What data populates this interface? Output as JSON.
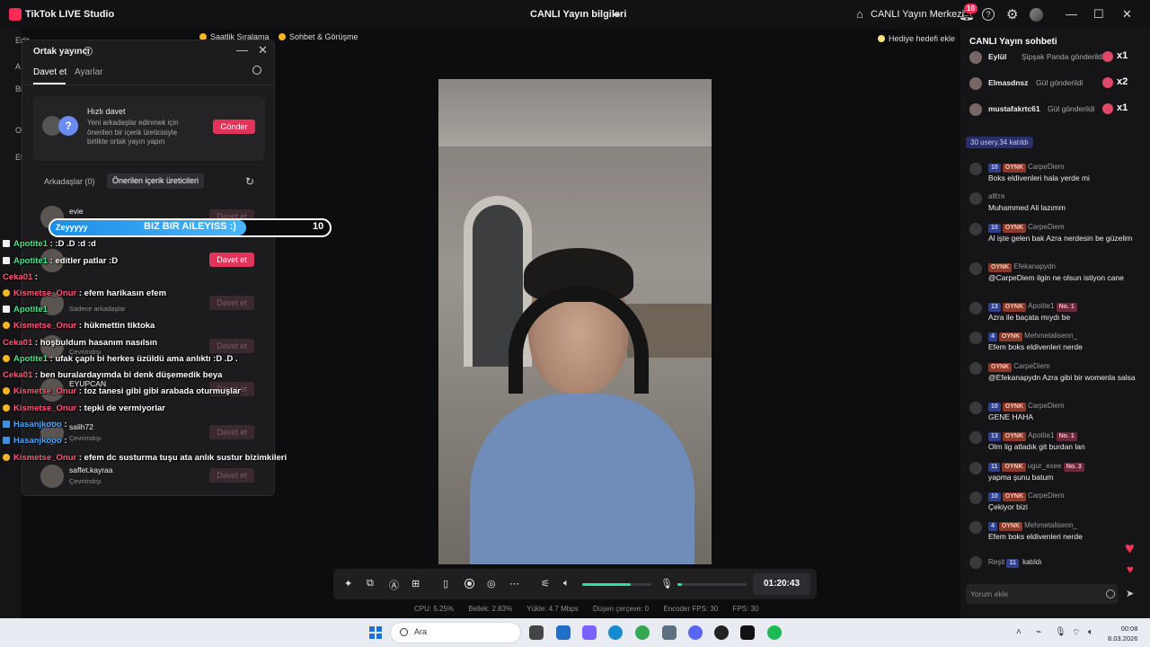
{
  "titlebar": {
    "app_name": "TikTok LIVE Studio",
    "center_title": "CANLI Yayın bilgileri",
    "live_center": "CANLI Yayın Merkezi",
    "notification_count": "10"
  },
  "top_pills": {
    "ranking": "Saatlik Sıralama",
    "chat": "Sohbet & Görüşme",
    "gift_goal": "Hediye hedefi ekle"
  },
  "left_edge": [
    "Edit",
    "A",
    "Bi",
    "O",
    "Et"
  ],
  "cohost_panel": {
    "title": "Ortak yayıncı",
    "tabs": [
      "Davet et",
      "Ayarlar"
    ],
    "quick_invite": {
      "title": "Hızlı davet",
      "description": "Yeni arkadaşlar edinmek için önerilen bir içerik üreticisiyle birlikte ortak yayın yapın",
      "button": "Gönder"
    },
    "list_tabs": [
      "Arkadaşlar (0)",
      "Önerilen içerik üreticileri"
    ],
    "people": [
      {
        "name": "evie",
        "sub": "",
        "button": "Davet et"
      },
      {
        "name": "",
        "sub": "",
        "button": "Davet et"
      },
      {
        "name": "",
        "sub": "Sadece arkadaşlar",
        "button": "Davet et"
      },
      {
        "name": "",
        "sub": "Çevrimdışı",
        "button": "Davet et"
      },
      {
        "name": "EYUPCAN",
        "sub": "",
        "button": "Davet et"
      },
      {
        "name": "salih72",
        "sub": "Çevrimdışı",
        "button": "Davet et"
      },
      {
        "name": "saffet.kayraa",
        "sub": "Çevrimdışı",
        "button": "Davet et"
      }
    ]
  },
  "overlay_goal": {
    "name": "Zeyyyyy",
    "text": "BIZ BIR AILEYISS :)",
    "count": "10",
    "progress": 0.7
  },
  "overlay_chat": [
    {
      "user": "Apotite1",
      "text": ": :D .D :d :d"
    },
    {
      "user": "Apotite1",
      "text": ": editler patlar :D"
    },
    {
      "user": "Ceka01",
      "text": ":"
    },
    {
      "user": "Kismetse_Onur",
      "text": ": efem harikasın efem"
    },
    {
      "user": "Apotite1",
      "text": ""
    },
    {
      "user": "Kismetse_Onur",
      "text": ": hükmettin tiktoka"
    },
    {
      "user": "Ceka01",
      "text": ": hoşbuldum hasanım nasılsın"
    },
    {
      "user": "Apotite1",
      "text": ": ufak çaplı bi herkes üzüldü ama anlıktı :D .D ."
    },
    {
      "user": "Ceka01",
      "text": ": ben buralardayımda bi denk düşemedik beya"
    },
    {
      "user": "Kismetse_Onur",
      "text": ": toz tanesi gibi gibi arabada oturmuşlar"
    },
    {
      "user": "Kismetse_Onur",
      "text": ": tepki de vermiyorlar"
    },
    {
      "user": "Hasanjkooo",
      "text": ":"
    },
    {
      "user": "Hasanjkooo",
      "text": ":"
    },
    {
      "user": "Kismetse_Onur",
      "text": ": efem dc susturma tuşu ata anlık sustur bizimkileri"
    }
  ],
  "right_chat": {
    "title": "CANLI Yayın sohbeti",
    "gifts": [
      {
        "user": "Eylül",
        "action": "Şipşak Panda gönderildi",
        "count": "x1"
      },
      {
        "user": "Elmasdnsz",
        "action": "Gül gönderildi",
        "count": "x2"
      },
      {
        "user": "mustafakrtc61",
        "action": "Gül gönderildi",
        "count": "x1"
      }
    ],
    "joined": {
      "level": "30",
      "text": "usery.34 katıldı"
    },
    "messages": [
      {
        "level": "10",
        "tag": "OYNK",
        "user": "CarpeDiem",
        "no": "",
        "text": "Boks eldivenleri hala yerde mi"
      },
      {
        "level": "",
        "tag": "",
        "user": "alltтя",
        "no": "",
        "text": "Muhammed Ali lazımm"
      },
      {
        "level": "10",
        "tag": "OYNK",
        "user": "CarpeDiem",
        "no": "",
        "text": "Al işte gelen bak Azra nerdesin be güzelim"
      },
      {
        "level": "",
        "tag": "OYNK",
        "user": "Efekanapydn",
        "no": "",
        "text": "@CarpeDiem ilgin ne olsun istiyon cane"
      },
      {
        "level": "13",
        "tag": "OYNK",
        "user": "Apotite1",
        "no": "No. 1",
        "text": "Azra ile baçata mıydı be"
      },
      {
        "level": "4",
        "tag": "OYNK",
        "user": "Mehmetalisenn_",
        "no": "",
        "text": "Efem boks eldivenleri nerde"
      },
      {
        "level": "",
        "tag": "OYNK",
        "user": "CarpeDiem",
        "no": "",
        "text": "@Efekanapydn Azra gibi bir womenla salsa"
      },
      {
        "level": "10",
        "tag": "OYNK",
        "user": "CarpeDiem",
        "no": "",
        "text": "GENE HAHA"
      },
      {
        "level": "13",
        "tag": "OYNK",
        "user": "Apotite1",
        "no": "No. 1",
        "text": "Olm lig atladık git burdan lan"
      },
      {
        "level": "11",
        "tag": "OYNK",
        "user": "ugur_exee",
        "no": "No. 3",
        "text": "yapma şunu batum"
      },
      {
        "level": "10",
        "tag": "OYNK",
        "user": "CarpeDiem",
        "no": "",
        "text": "Çekiyor bizi"
      },
      {
        "level": "4",
        "tag": "OYNK",
        "user": "Mehmetalisenn_",
        "no": "",
        "text": "Efem boks eldivenleri nerde"
      }
    ],
    "last_join": {
      "user": "Reşit",
      "level": "11",
      "text": "katıldı"
    },
    "input_placeholder": "Yorum ekle"
  },
  "controls": {
    "timer": "01:20:43",
    "volume_level": 0.7,
    "mic_level": 0.06
  },
  "stats": {
    "cpu": "CPU: 5.25%",
    "memory": "Bellek: 2.83%",
    "upload": "Yükle: 4.7 Mbps",
    "dropped": "Düşen çerçeve: 0",
    "encoder_fps": "Encoder FPS: 30",
    "fps": "FPS: 30"
  },
  "taskbar": {
    "search": "Ara",
    "time": "00:08",
    "date": "8.03.2026"
  },
  "colors": {
    "accent": "#e0345a",
    "volume": "#2ee0a4",
    "goal": "#1b8fe8"
  }
}
